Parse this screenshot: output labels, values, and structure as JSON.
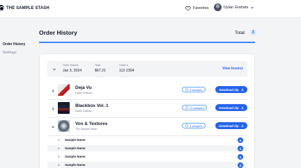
{
  "header": {
    "brand": "THE SAMPLE STASH",
    "favorites_label": "Favorites",
    "user_name": "Dylan Graham"
  },
  "sidebar": {
    "items": [
      {
        "label": "Order History",
        "active": true
      },
      {
        "label": "Settings",
        "active": false
      }
    ]
  },
  "main": {
    "title": "Order History",
    "total_label": "Total:",
    "total_count": "3"
  },
  "order": {
    "placed_label": "Order Placed",
    "placed_value": "Jan 3, 2024",
    "total_label": "Total",
    "total_value": "$67.21",
    "number_label": "Order #",
    "number_value": "112-2304",
    "view_invoice": "View Invoice",
    "packs": [
      {
        "name": "Deja Vu",
        "artist": "Dylan Graham",
        "samples": "3 samples",
        "download": "Download Zip",
        "expanded": false
      },
      {
        "name": "Blackbox Vol. 1",
        "artist": "Dylan Graham",
        "samples": "70 samples",
        "download": "Download Zip",
        "expanded": false
      },
      {
        "name": "Vox & Textures",
        "artist": "The Sample Stash",
        "samples": "4 samples",
        "download": "Download Zip",
        "expanded": true
      }
    ],
    "samples": [
      {
        "num": "1.",
        "name": "Sample Name"
      },
      {
        "num": "2.",
        "name": "Sample Name"
      },
      {
        "num": "3.",
        "name": "Sample Name"
      },
      {
        "num": "4.",
        "name": "Sample Name"
      }
    ]
  },
  "colors": {
    "accent": "#2563eb",
    "background": "#f3f4f6"
  },
  "icons": [
    "logo-icon",
    "heart-icon",
    "avatar",
    "chevron-down-icon",
    "chevron-right-icon",
    "sample-wave-icon",
    "download-icon"
  ]
}
